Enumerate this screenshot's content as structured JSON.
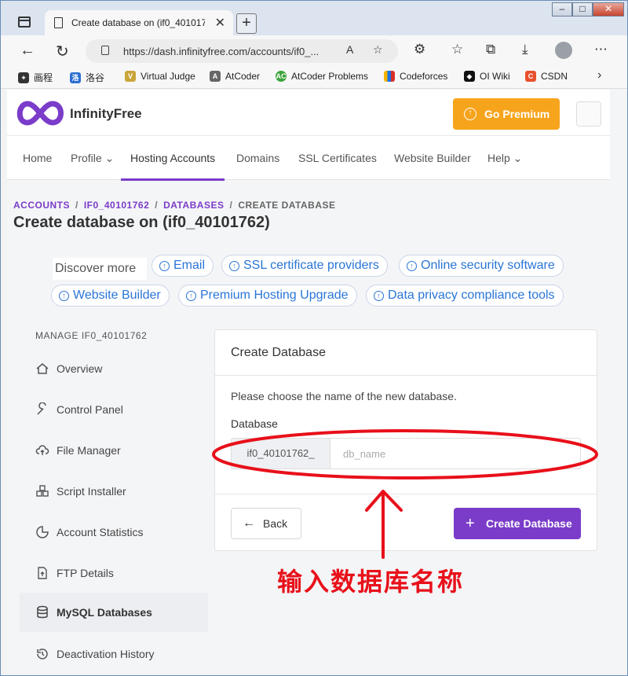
{
  "browser": {
    "tab_title": "Create database on (if0_40101762",
    "tab_close": "✕",
    "new_tab": "+",
    "window_minimize": "–",
    "window_maximize": "□",
    "window_close": "✕",
    "url": "https://dash.infinityfree.com/accounts/if0_...",
    "bookmarks": [
      {
        "label": "洛谷"
      },
      {
        "label": "Virtual Judge"
      },
      {
        "label": "AtCoder"
      },
      {
        "label": "AtCoder Problems"
      },
      {
        "label": "Codeforces"
      },
      {
        "label": "OI Wiki"
      },
      {
        "label": "CSDN"
      }
    ],
    "bookmark_first": "画程"
  },
  "site": {
    "brand": "InfinityFree",
    "premium_label": "Go Premium",
    "nav": [
      {
        "label": "Home"
      },
      {
        "label": "Profile"
      },
      {
        "label": "Hosting Accounts"
      },
      {
        "label": "Domains"
      },
      {
        "label": "SSL Certificates"
      },
      {
        "label": "Website Builder"
      },
      {
        "label": "Help"
      }
    ],
    "colors": {
      "accent": "#7a3cc9",
      "premium": "#f7a41d",
      "link": "#2a75d6",
      "annotation": "#e8101a"
    }
  },
  "breadcrumb": [
    "ACCOUNTS",
    "IF0_40101762",
    "DATABASES",
    "CREATE DATABASE"
  ],
  "breadcrumb_sep": "/",
  "page_title": "Create database on (if0_40101762)",
  "discover": {
    "label": "Discover more",
    "chips": [
      {
        "label": "Email"
      },
      {
        "label": "SSL certificate providers"
      },
      {
        "label": "Online security software"
      },
      {
        "label": "Website Builder"
      },
      {
        "label": "Premium Hosting Upgrade"
      },
      {
        "label": "Data privacy compliance tools"
      }
    ]
  },
  "sidebar": {
    "heading": "MANAGE IF0_40101762",
    "items": [
      {
        "label": "Overview",
        "icon": "home-icon"
      },
      {
        "label": "Control Panel",
        "icon": "wrench-icon"
      },
      {
        "label": "File Manager",
        "icon": "cloud-upload-icon"
      },
      {
        "label": "Script Installer",
        "icon": "cubes-icon"
      },
      {
        "label": "Account Statistics",
        "icon": "pie-chart-icon"
      },
      {
        "label": "FTP Details",
        "icon": "file-upload-icon"
      },
      {
        "label": "MySQL Databases",
        "icon": "database-icon"
      },
      {
        "label": "Deactivation History",
        "icon": "history-icon"
      }
    ],
    "active": "MySQL Databases"
  },
  "form": {
    "title": "Create Database",
    "description": "Please choose the name of the new database.",
    "field_label": "Database",
    "prefix": "if0_40101762_",
    "placeholder": "db_name",
    "value": "",
    "back_label": "Back",
    "create_label": "Create Database"
  },
  "annotation": {
    "text": "输入数据库名称"
  }
}
